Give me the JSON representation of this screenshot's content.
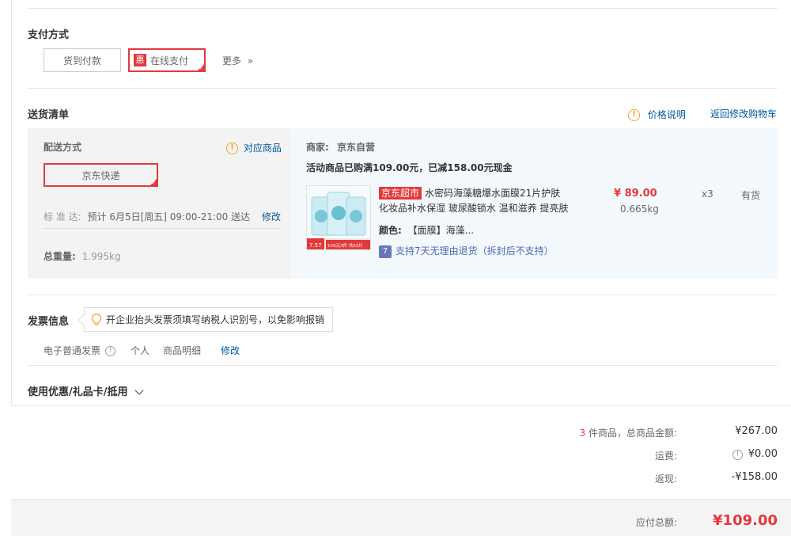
{
  "payment": {
    "title": "支付方式",
    "cod_label": "货到付款",
    "online_badge": "惠",
    "online_label": "在线支付",
    "more_label": "更多",
    "more_arrow": "»"
  },
  "delivery": {
    "title": "送货清单",
    "price_help": "价格说明",
    "back_to_cart": "返回修改购物车",
    "ship_method_label": "配送方式",
    "related_goods": "对应商品",
    "ship_option": "京东快递",
    "standard_label": "标 准 达:",
    "standard_value": "预计 6月5日[周五] 09:00-21:00 送达",
    "modify": "修改",
    "total_weight_label": "总重量:",
    "total_weight_value": "1.995kg",
    "seller_label": "商家:",
    "seller_value": "京东自营",
    "promo": "活动商品已购满109.00元，已减158.00元现金",
    "product": {
      "store_tag": "京东超市",
      "name_line1": "水密码海藻糖爆水面膜21片护肤",
      "name_line2": "化妆品补水保湿 玻尿酸锁水 温和滋养 提亮肤",
      "price": "¥ 89.00",
      "weight": "0.665kg",
      "qty": "x3",
      "stock": "有货",
      "color_label": "颜色:",
      "color_value": "【面膜】海藻...",
      "returns_icon": "7",
      "returns": "支持7天无理由退货（拆封后不支持）",
      "img_badge1": "7.57",
      "img_badge2": "109元3件 共63片"
    }
  },
  "invoice": {
    "title": "发票信息",
    "tip": "开企业抬头发票须填写纳税人识别号，以免影响报销",
    "type": "电子普通发票",
    "info_icon": "!",
    "holder": "个人",
    "content": "商品明细",
    "modify": "修改"
  },
  "coupons": {
    "title": "使用优惠/礼品卡/抵用"
  },
  "summary": {
    "count": "3",
    "count_suffix": "件商品，总商品金额:",
    "goods_total": "¥267.00",
    "shipping_label": "运费:",
    "shipping_value": "¥0.00",
    "cashback_label": "返现:",
    "cashback_value": "-¥158.00",
    "payable_label": "应付总额:",
    "payable_value": "¥109.00"
  },
  "colors": {
    "accent_red": "#e4393c",
    "link_blue": "#005aa0",
    "warn_orange": "#f5a623"
  }
}
